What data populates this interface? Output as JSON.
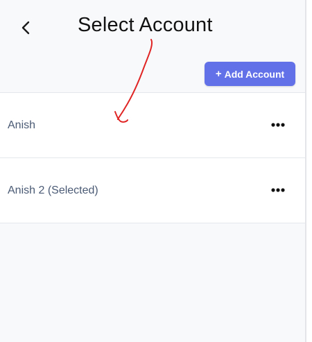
{
  "header": {
    "title": "Select Account",
    "back_icon": "chevron-left-icon"
  },
  "toolbar": {
    "add_account_plus": "+",
    "add_account_label": "Add Account",
    "add_account_color": "#6371e8"
  },
  "accounts": [
    {
      "name": "Anish",
      "menu_icon": "more-horizontal-icon"
    },
    {
      "name": "Anish 2 (Selected)",
      "menu_icon": "more-horizontal-icon"
    }
  ],
  "annotation": {
    "type": "hand-drawn-arrow",
    "color": "#e02424"
  }
}
